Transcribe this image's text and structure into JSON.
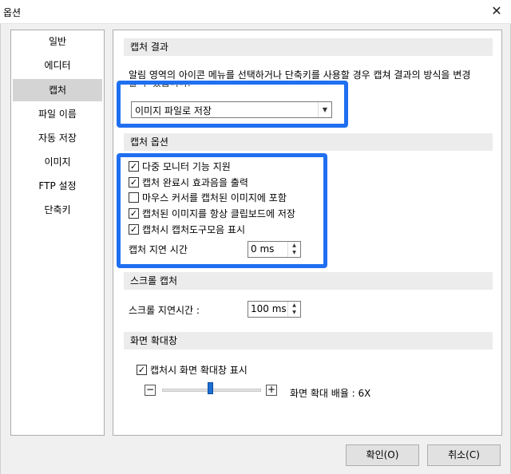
{
  "window": {
    "title": "옵션",
    "close_glyph": "✕"
  },
  "sidebar": {
    "items": [
      {
        "label": "일반"
      },
      {
        "label": "에디터"
      },
      {
        "label": "캡처"
      },
      {
        "label": "파일 이름"
      },
      {
        "label": "자동 저장"
      },
      {
        "label": "이미지"
      },
      {
        "label": "FTP 설정"
      },
      {
        "label": "단축키"
      }
    ],
    "selected": "캡처"
  },
  "capture_result": {
    "header": "캡처 결과",
    "description": "알림 영역의 아이콘 메뉴를 선택하거나 단축키를 사용할 경우 캡쳐 결과의 방식을 변경",
    "description_line2": "할 수 있습니다.",
    "dropdown_value": "이미지 파일로 저장"
  },
  "capture_options": {
    "header": "캡처 옵션",
    "checkboxes": [
      {
        "label": "다중 모니터 기능 지원",
        "checked": true
      },
      {
        "label": "캡처 완료시 효과음을 출력",
        "checked": true
      },
      {
        "label": "마우스 커서를 캡처된 이미지에 포함",
        "checked": false
      },
      {
        "label": "캡처된 이미지를 항상 클립보드에 저장",
        "checked": true
      },
      {
        "label": "캡처시 캡처도구모음 표시",
        "checked": true
      }
    ],
    "delay_label": "캡처 지연 시간",
    "delay_value": "0 ms"
  },
  "scroll_capture": {
    "header": "스크롤 캡처",
    "delay_label": "스크롤 지연시간 :",
    "delay_value": "100 ms"
  },
  "magnifier": {
    "header": "화면 확대창",
    "checkbox_label": "캡처시 화면 확대창 표시",
    "checkbox_checked": true,
    "zoom_label": "화면 확대 배율 : 6X",
    "zoom_level_fraction": 0.5
  },
  "buttons": {
    "ok": "확인(O)",
    "cancel": "취소(C)"
  },
  "icons": {
    "check": "✓",
    "combo_arrow": "▼",
    "spin_up": "▲",
    "spin_down": "▼",
    "minus": "−",
    "plus": "+"
  },
  "colors": {
    "highlight": "#1f6ff0",
    "selected_item_bg": "#d4d4d4",
    "slider_thumb": "#1c6fd3"
  }
}
